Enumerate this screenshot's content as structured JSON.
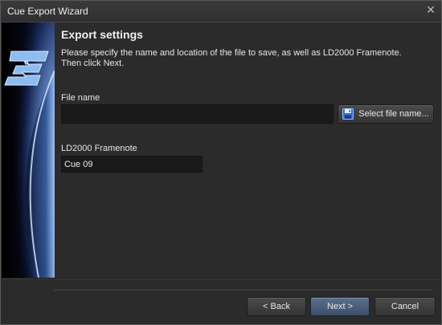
{
  "window": {
    "title": "Cue Export Wizard",
    "close_glyph": "✕"
  },
  "banner": {
    "logo_icon": "stylized-3-logo-icon",
    "colors": {
      "logo": "#7fb2e8",
      "space": "#06091a",
      "planet_glow": "#a8c8ff"
    }
  },
  "page": {
    "heading": "Export settings",
    "description_line1": "Please specify the name and location of the file to save, as well as LD2000 Framenote.",
    "description_line2": "Then click Next."
  },
  "file_name": {
    "label": "File name",
    "value": "",
    "select_button_label": "Select file name...",
    "select_button_icon": "floppy-disk-icon"
  },
  "framenote": {
    "label": "LD2000 Framenote",
    "value": "Cue 09"
  },
  "footer": {
    "back_label": "< Back",
    "next_label": "Next >",
    "cancel_label": "Cancel"
  }
}
